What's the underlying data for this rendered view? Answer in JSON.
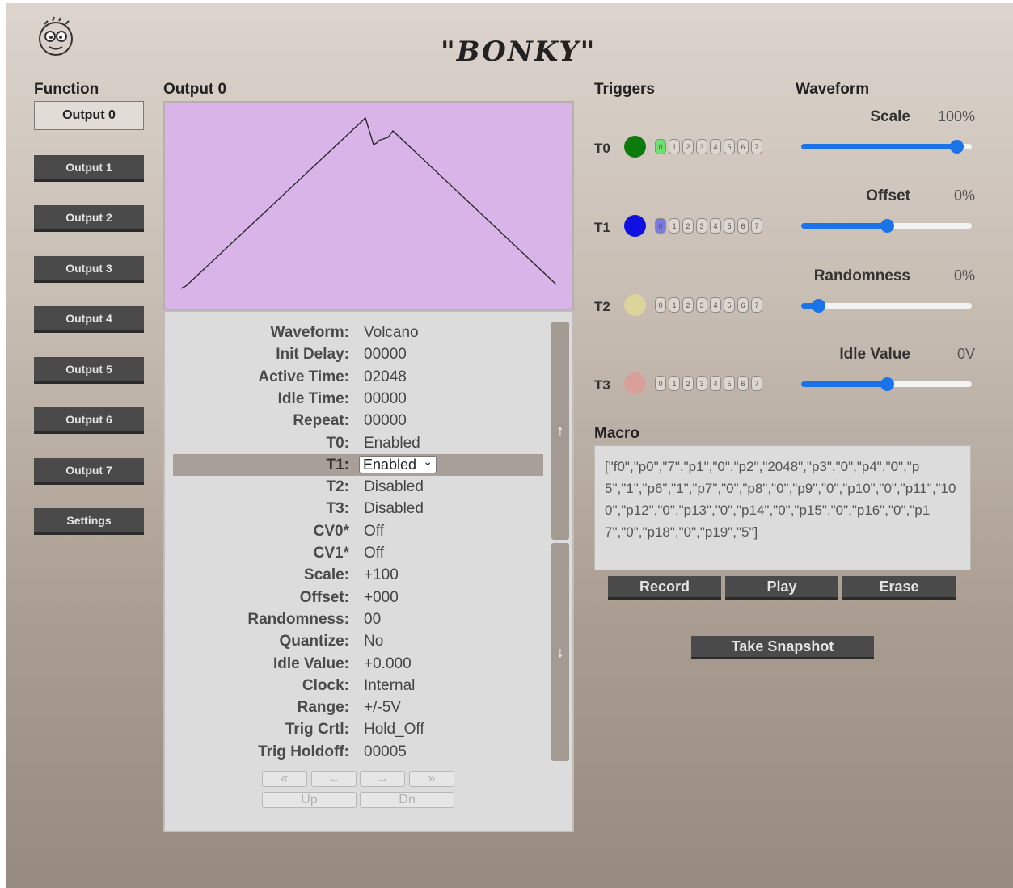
{
  "app": {
    "title": "\"BONKY\""
  },
  "function": {
    "heading": "Function",
    "buttons": [
      "Output 0",
      "Output 1",
      "Output 2",
      "Output 3",
      "Output 4",
      "Output 5",
      "Output 6",
      "Output 7",
      "Settings"
    ],
    "active": "Output 0"
  },
  "output": {
    "heading": "Output 0",
    "graph_color": "#d8b4e8",
    "params": [
      {
        "label": "Waveform:",
        "value": "Volcano"
      },
      {
        "label": "Init Delay:",
        "value": "00000"
      },
      {
        "label": "Active Time:",
        "value": "02048"
      },
      {
        "label": "Idle Time:",
        "value": "00000"
      },
      {
        "label": "Repeat:",
        "value": "00000"
      },
      {
        "label": "T0:",
        "value": "Enabled"
      },
      {
        "label": "T1:",
        "value": "Enabled"
      },
      {
        "label": "T2:",
        "value": "Disabled"
      },
      {
        "label": "T3:",
        "value": "Disabled"
      },
      {
        "label": "CV0*",
        "value": "Off"
      },
      {
        "label": "CV1*",
        "value": "Off"
      },
      {
        "label": "Scale:",
        "value": "+100"
      },
      {
        "label": "Offset:",
        "value": "+000"
      },
      {
        "label": "Randomness:",
        "value": "00"
      },
      {
        "label": "Quantize:",
        "value": "No"
      },
      {
        "label": "Idle Value:",
        "value": "+0.000"
      },
      {
        "label": "Clock:",
        "value": "Internal"
      },
      {
        "label": "Range:",
        "value": "+/-5V"
      },
      {
        "label": "Trig Crtl:",
        "value": "Hold_Off"
      },
      {
        "label": "Trig Holdoff:",
        "value": "00005"
      }
    ],
    "selected_row": "T1:",
    "scroll_up": "↑",
    "scroll_down": "↓",
    "nav": {
      "first": "«",
      "prev": "←",
      "next": "→",
      "last": "»",
      "up": "Up",
      "dn": "Dn"
    }
  },
  "triggers": {
    "heading": "Triggers",
    "rows": [
      {
        "label": "T0",
        "color": "#0d7a0d",
        "active_bit": 0,
        "active_color": "#6ee06e"
      },
      {
        "label": "T1",
        "color": "#1010e0",
        "active_bit": 0,
        "active_color": "#7a7ae0"
      },
      {
        "label": "T2",
        "color": "#ddd49c",
        "active_bit": -1,
        "active_color": ""
      },
      {
        "label": "T3",
        "color": "#d9a09a",
        "active_bit": -1,
        "active_color": ""
      }
    ],
    "bits": [
      "0",
      "1",
      "2",
      "3",
      "4",
      "5",
      "6",
      "7"
    ]
  },
  "waveform": {
    "heading": "Waveform",
    "sliders": [
      {
        "label": "Scale",
        "value_text": "100%",
        "level": 0.91
      },
      {
        "label": "Offset",
        "value_text": "0%",
        "level": 0.5
      },
      {
        "label": "Randomness",
        "value_text": "0%",
        "level": 0.1
      },
      {
        "label": "Idle Value",
        "value_text": "0V",
        "level": 0.5
      }
    ]
  },
  "macro": {
    "heading": "Macro",
    "text": "[\"f0\",\"p0\",\"7\",\"p1\",\"0\",\"p2\",\"2048\",\"p3\",\"0\",\"p4\",\"0\",\"p5\",\"1\",\"p6\",\"1\",\"p7\",\"0\",\"p8\",\"0\",\"p9\",\"0\",\"p10\",\"0\",\"p11\",\"100\",\"p12\",\"0\",\"p13\",\"0\",\"p14\",\"0\",\"p15\",\"0\",\"p16\",\"0\",\"p17\",\"0\",\"p18\",\"0\",\"p19\",\"5\"]",
    "buttons": {
      "record": "Record",
      "play": "Play",
      "erase": "Erase"
    },
    "snapshot": "Take Snapshot"
  },
  "colors": {
    "accent": "#1a73e8",
    "button": "#4a4a4a"
  }
}
